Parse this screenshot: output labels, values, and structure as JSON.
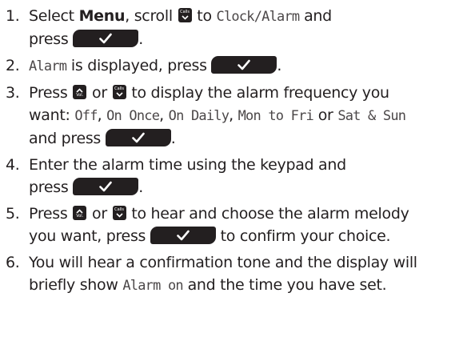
{
  "steps": [
    {
      "number": "1.",
      "parts": [
        {
          "type": "text",
          "value": "Select "
        },
        {
          "type": "bold",
          "value": "Menu"
        },
        {
          "type": "text",
          "value": ", scroll "
        },
        {
          "type": "icon",
          "icon": "down",
          "label": "Calls"
        },
        {
          "type": "text",
          "value": " to "
        },
        {
          "type": "lcd",
          "value": "Clock/Alarm"
        },
        {
          "type": "text",
          "value": " and"
        },
        {
          "type": "break"
        },
        {
          "type": "text",
          "value": "press "
        },
        {
          "type": "ok"
        },
        {
          "type": "text",
          "value": "."
        }
      ]
    },
    {
      "number": "2.",
      "parts": [
        {
          "type": "lcd",
          "value": "Alarm"
        },
        {
          "type": "text",
          "value": " is displayed, press "
        },
        {
          "type": "ok"
        },
        {
          "type": "text",
          "value": "."
        }
      ]
    },
    {
      "number": "3.",
      "parts": [
        {
          "type": "text",
          "value": "Press "
        },
        {
          "type": "icon",
          "icon": "up",
          "label": "Vol."
        },
        {
          "type": "text",
          "value": " or "
        },
        {
          "type": "icon",
          "icon": "down",
          "label": "Calls"
        },
        {
          "type": "text",
          "value": " to display the alarm frequency you"
        },
        {
          "type": "break"
        },
        {
          "type": "text",
          "value": "want: "
        },
        {
          "type": "lcd",
          "value": "Off"
        },
        {
          "type": "text",
          "value": ", "
        },
        {
          "type": "lcd",
          "value": "On Once"
        },
        {
          "type": "text",
          "value": ", "
        },
        {
          "type": "lcd",
          "value": "On Daily"
        },
        {
          "type": "text",
          "value": ", "
        },
        {
          "type": "lcd",
          "value": "Mon to Fri"
        },
        {
          "type": "text",
          "value": " or "
        },
        {
          "type": "lcd",
          "value": "Sat & Sun"
        },
        {
          "type": "break"
        },
        {
          "type": "text",
          "value": "and press "
        },
        {
          "type": "ok"
        },
        {
          "type": "text",
          "value": "."
        }
      ]
    },
    {
      "number": "4.",
      "parts": [
        {
          "type": "text",
          "value": "Enter the alarm time using the keypad and"
        },
        {
          "type": "break"
        },
        {
          "type": "text",
          "value": "press "
        },
        {
          "type": "ok"
        },
        {
          "type": "text",
          "value": "."
        }
      ]
    },
    {
      "number": "5.",
      "parts": [
        {
          "type": "text",
          "value": "Press "
        },
        {
          "type": "icon",
          "icon": "up",
          "label": "Vol."
        },
        {
          "type": "text",
          "value": " or "
        },
        {
          "type": "icon",
          "icon": "down",
          "label": "Calls"
        },
        {
          "type": "text",
          "value": " to hear and choose the alarm melody"
        },
        {
          "type": "break"
        },
        {
          "type": "text",
          "value": "you want, press "
        },
        {
          "type": "ok"
        },
        {
          "type": "text",
          "value": " to confirm your choice."
        }
      ]
    },
    {
      "number": "6.",
      "parts": [
        {
          "type": "text",
          "value": "You will hear a confirmation tone and the display will"
        },
        {
          "type": "break"
        },
        {
          "type": "text",
          "value": "briefly show "
        },
        {
          "type": "lcd",
          "value": "Alarm on"
        },
        {
          "type": "text",
          "value": " and the time you have set."
        }
      ]
    }
  ]
}
